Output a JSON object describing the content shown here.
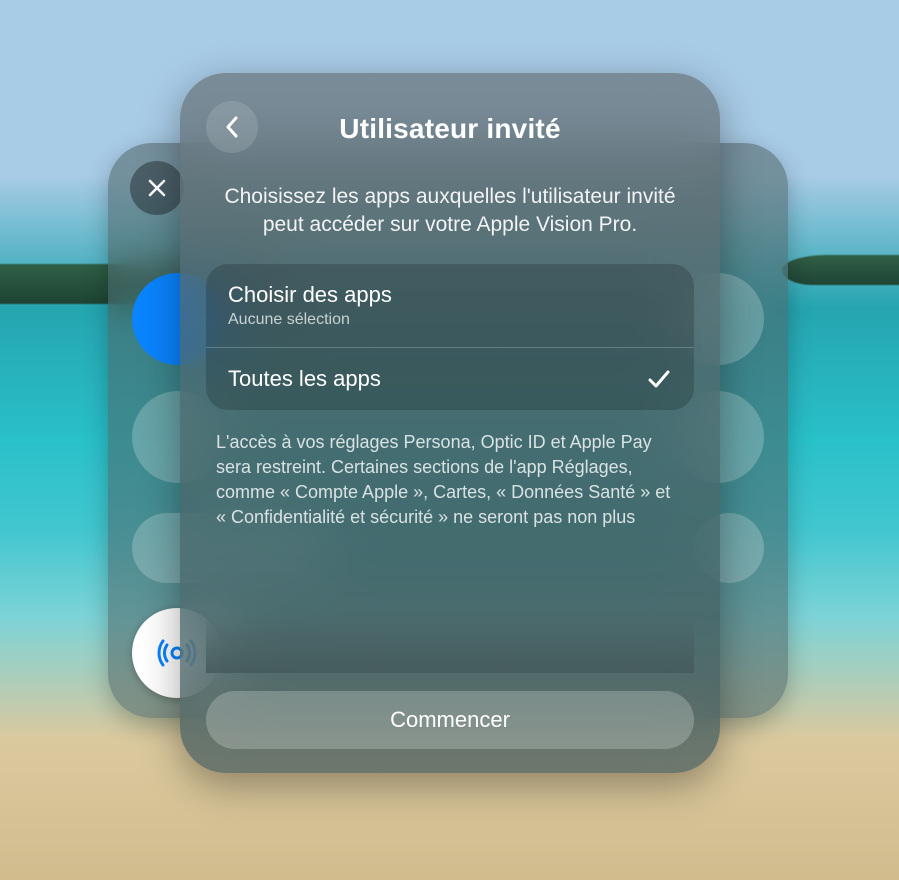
{
  "modal": {
    "title": "Utilisateur invité",
    "description": "Choisissez les apps auxquelles l'utilisateur invité peut accéder sur votre Apple Vision Pro.",
    "options": {
      "choose": {
        "title": "Choisir des apps",
        "subtitle": "Aucune sélection",
        "selected": false
      },
      "all": {
        "title": "Toutes les apps",
        "selected": true
      }
    },
    "footnote": "L'accès à vos réglages Persona, Optic ID et Apple Pay sera restreint. Certaines sections de l'app Réglages, comme « Compte Apple », Cartes, « Données Santé » et « Confidentialité et sécurité » ne seront pas non plus",
    "primaryAction": "Commencer"
  },
  "icons": {
    "back": "chevron-left",
    "close": "xmark",
    "check": "checkmark"
  }
}
